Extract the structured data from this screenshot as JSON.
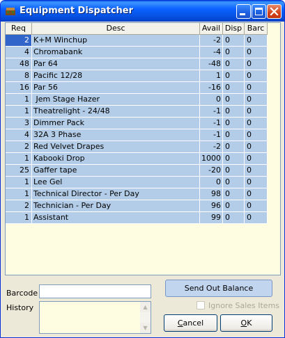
{
  "window": {
    "title": "Equipment Dispatcher"
  },
  "grid": {
    "columns": [
      "Req",
      "Desc",
      "Avail",
      "Disp",
      "Barc"
    ],
    "rows": [
      {
        "req": "2",
        "desc": "K+M Winchup",
        "avail": "-2",
        "disp": "0",
        "barc": "0"
      },
      {
        "req": "4",
        "desc": "Chromabank",
        "avail": "-4",
        "disp": "0",
        "barc": "0"
      },
      {
        "req": "48",
        "desc": "Par 64",
        "avail": "-48",
        "disp": "0",
        "barc": "0"
      },
      {
        "req": "8",
        "desc": "Pacific 12/28",
        "avail": "1",
        "disp": "0",
        "barc": "0"
      },
      {
        "req": "16",
        "desc": "Par 56",
        "avail": "-16",
        "disp": "0",
        "barc": "0"
      },
      {
        "req": "1",
        "desc": " Jem Stage Hazer",
        "avail": "0",
        "disp": "0",
        "barc": "0"
      },
      {
        "req": "1",
        "desc": "Theatrelight - 24/48",
        "avail": "-1",
        "disp": "0",
        "barc": "0"
      },
      {
        "req": "3",
        "desc": "Dimmer Pack",
        "avail": "-1",
        "disp": "0",
        "barc": "0"
      },
      {
        "req": "4",
        "desc": "32A 3 Phase",
        "avail": "-1",
        "disp": "0",
        "barc": "0"
      },
      {
        "req": "2",
        "desc": "Red Velvet Drapes",
        "avail": "-2",
        "disp": "0",
        "barc": "0"
      },
      {
        "req": "1",
        "desc": "Kabooki Drop",
        "avail": "1000",
        "disp": "0",
        "barc": "0"
      },
      {
        "req": "25",
        "desc": "Gaffer tape",
        "avail": "-20",
        "disp": "0",
        "barc": "0"
      },
      {
        "req": "1",
        "desc": "Lee Gel",
        "avail": "0",
        "disp": "0",
        "barc": "0"
      },
      {
        "req": "1",
        "desc": "Technical Director - Per Day",
        "avail": "98",
        "disp": "0",
        "barc": "0"
      },
      {
        "req": "2",
        "desc": "Technician - Per Day",
        "avail": "96",
        "disp": "0",
        "barc": "0"
      },
      {
        "req": "1",
        "desc": "Assistant",
        "avail": "99",
        "disp": "0",
        "barc": "0"
      }
    ]
  },
  "form": {
    "barcode_label": "Barcode",
    "barcode_value": "",
    "history_label": "History",
    "history_value": ""
  },
  "buttons": {
    "send_out_balance": "Send Out Balance",
    "cancel_prefix": "",
    "cancel_mnemonic": "C",
    "cancel_rest": "ancel",
    "ok_prefix": "",
    "ok_mnemonic": "O",
    "ok_rest": "K"
  },
  "options": {
    "ignore_sales_items": "Ignore Sales Items",
    "ignore_sales_items_checked": false
  },
  "icons": [
    "app-icon",
    "minimize-icon",
    "maximize-icon",
    "close-icon",
    "scroll-up-icon",
    "scroll-down-icon"
  ]
}
